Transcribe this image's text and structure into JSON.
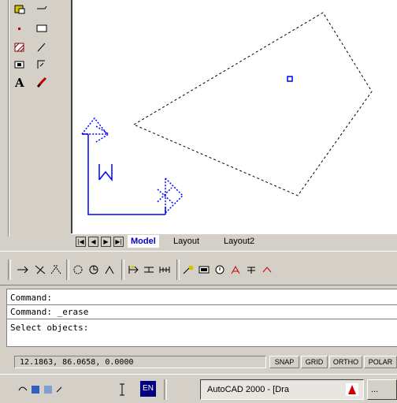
{
  "layout_tabs": {
    "nav": [
      "|◀",
      "◀",
      "▶",
      "▶|"
    ],
    "items": [
      {
        "label": "Model",
        "active": true
      },
      {
        "label": "Layout",
        "active": false
      },
      {
        "label": "Layout2",
        "active": false
      }
    ]
  },
  "command": {
    "lines": [
      "Command:",
      "Command: _erase",
      "Select objects:"
    ]
  },
  "status": {
    "coords": "12.1863, 86.0658, 0.0000",
    "toggles": [
      "SNAP",
      "GRID",
      "ORTHO",
      "POLAR"
    ]
  },
  "taskbar": {
    "language": "EN",
    "active_task": "AutoCAD 2000 - [Dra",
    "other_task": "..."
  },
  "colors": {
    "ucs_icon": "#0000ff",
    "grip": "#0000ff",
    "active_tab": "#0000c8"
  },
  "icons": {
    "left_toolbar": [
      "insert-block-icon",
      "hatch-icon",
      "point-icon",
      "region-icon",
      "table-icon",
      "multiline-text-icon",
      "text-icon",
      "make-block-icon"
    ],
    "modify_toolbar": [
      "stretch-icon",
      "trim-icon",
      "extend-icon",
      "rotate-icon",
      "scale-icon",
      "mirror-icon",
      "break-icon",
      "join-icon",
      "chamfer-icon",
      "fillet-icon",
      "explode-icon",
      "properties-icon",
      "match-icon"
    ]
  }
}
